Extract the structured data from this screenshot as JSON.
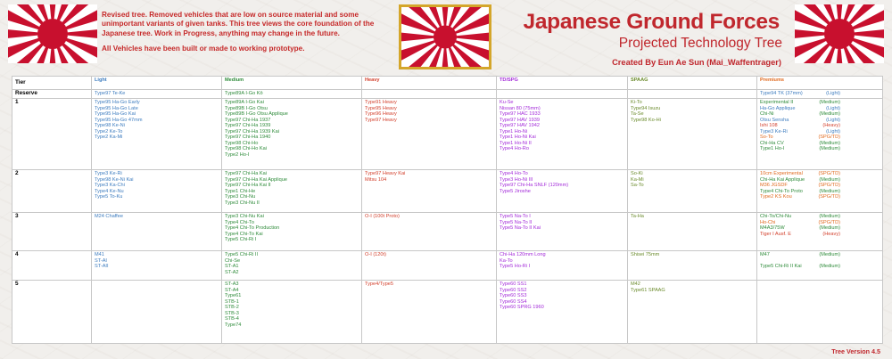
{
  "intro": {
    "p1": "Revised tree. Removed vehicles that are low on source material and some unimportant variants of given tanks. This tree views the core foundation of the Japanese tree. Work in Progress, anything may change in the future.",
    "p2": "All Vehicles have been built or made to working prototype."
  },
  "title": {
    "main": "Japanese Ground Forces",
    "sub": "Projected Technology Tree",
    "by": "Created By Eun Ae Sun (Mai_Waffentrager)"
  },
  "colors": {
    "light": "#3d7cbf",
    "medium": "#2e8b3a",
    "heavy": "#d23e2a",
    "td": "#a32bd9",
    "spaag": "#6b8b2c",
    "premium": "#e06a1f",
    "title": "#c0272d"
  },
  "headers": {
    "tier": "Tier",
    "light": "Light",
    "medium": "Medium",
    "heavy": "Heavy",
    "td": "TD/SPG",
    "spaag": "SPAAG",
    "premiums": "Premiums"
  },
  "rows": [
    {
      "tier": "Reserve",
      "light": [
        "Type97 Te-Ke"
      ],
      "medium": [
        "Type89A I-Go Kō"
      ],
      "heavy": [],
      "td": [],
      "spaag": [],
      "premiums": [
        {
          "name": "Type94 TK (37mm)",
          "tag": "(Light)"
        }
      ]
    },
    {
      "tier": "1",
      "light": [
        "Type95 Ha-Go Early",
        "Type95 Ha-Go Late",
        "Type95 Ha-Go Kai",
        "Type95 Ha-Go 47mm",
        "Type98 Ke-Ni",
        "Type2 Ke-To",
        "Type2 Ka-Mi"
      ],
      "medium": [
        "Type89A I-Go Kai",
        "Type89B I-Go Otsu",
        "Type89B I-Go Otsu Applique",
        "Type97 Chi-Ha 1937",
        "Type97 Chi-Ha 1939",
        "Type97 Chi-Ha 1939 Kai",
        "Type97 Chi-Ha 1940",
        "Type98 Chi-Ho",
        "Type98 Chi-Ho Kai",
        "Type2 Ho-I"
      ],
      "heavy": [
        "Type91 Heavy",
        "Type95 Heavy",
        "Type96 Heavy",
        "Type97 Heavy"
      ],
      "td": [
        "Ku-Se",
        "Nissan 80 (75mm)",
        "Type97 HAC 1933",
        "Type97 HAV 1939",
        "Type97 HAV 1942",
        "Type1 Ho-Ni",
        "Type1 Ho-Ni Kai",
        "Type1 Ho-Ni II",
        "Type4 Ho-Ro"
      ],
      "spaag": [
        "Ki-To",
        "Type94 Isuzu",
        "Ta-Se",
        "Type98 Ko-Hi"
      ],
      "premiums": [
        {
          "name": "Experimental II",
          "tag": "(Medium)"
        },
        {
          "name": "Ha-Go Applique",
          "tag": "(Light)"
        },
        {
          "name": "Chi-Ni",
          "tag": "(Medium)"
        },
        {
          "name": "Otsu Sensha",
          "tag": "(Light)"
        },
        {
          "name": "Ishi 108",
          "tag": "(Heavy)"
        },
        {
          "name": "Type3 Ke-Ri",
          "tag": "(Light)"
        },
        {
          "name": "So-To",
          "tag": "(SPG/TD)"
        },
        {
          "name": "Chi-Ha CV",
          "tag": "(Medium)"
        },
        {
          "name": "Type1 Ho-I",
          "tag": "(Medium)"
        }
      ]
    },
    {
      "tier": "2",
      "light": [
        "Type3 Ke-Ri",
        "Type98 Ke-Ni Kai",
        "Type3 Ka-Chi",
        "Type4 Ke-Nu",
        "Type5 To-Ku"
      ],
      "medium": [
        "Type97 Chi-Ha Kai",
        "Type97 Chi-Ha Kai Applique",
        "Type97 Chi-Ha Kai II",
        "Type1 Chi-He",
        "Type3 Chi-Nu",
        "Type3 Chi-Nu II"
      ],
      "heavy": [
        "Type97 Heavy Kai",
        "Mitsu 104"
      ],
      "td": [
        "Type4 Ho-To",
        "Type3 Ho-Ni III",
        "Type97 Chi-Ha SNLF (120mm)",
        "Type5 Jiroshe"
      ],
      "spaag": [
        "So-Ki",
        "Ka-Mi",
        "Sa-To"
      ],
      "premiums": [
        {
          "name": "10cm Experimental",
          "tag": "(SPG/TD)"
        },
        {
          "name": "Chi-Ha Kai Applique",
          "tag": "(Medium)"
        },
        {
          "name": "M36 JGSDF",
          "tag": "(SPG/TD)"
        },
        {
          "name": "Type4 Chi-To Proto",
          "tag": "(Medium)"
        },
        {
          "name": "Type2 KS Kou",
          "tag": "(SPG/TD)"
        }
      ]
    },
    {
      "tier": "3",
      "light": [
        "M24 Chaffee"
      ],
      "medium": [
        "Type3 Chi-Nu Kai",
        "Type4 Chi-To",
        "Type4 Chi-To Production",
        "Type4 Chi-To Kai",
        "Type5 Chi-Ri I"
      ],
      "heavy": [
        "O-I (100t Proto)"
      ],
      "td": [
        "Type5 Na-To I",
        "Type5 Na-To II",
        "Type5 Na-To II Kai"
      ],
      "spaag": [
        "Ta-Ha"
      ],
      "premiums": [
        {
          "name": "Chi-To/Chi-Nu",
          "tag": "(Medium)"
        },
        {
          "name": "Ho-Chi",
          "tag": "(SPG/TD)"
        },
        {
          "name": "M4A3/75W",
          "tag": "(Medium)"
        },
        {
          "name": "Tiger I Ausf. E",
          "tag": "(Heavy)"
        }
      ]
    },
    {
      "tier": "4",
      "light": [
        "M41",
        "ST-AI",
        "ST-AII"
      ],
      "medium": [
        "Type5 Chi-Ri II",
        "Chi-Se",
        "ST-A1",
        "ST-A2"
      ],
      "heavy": [
        "O-I (120t)"
      ],
      "td": [
        "Chi-Ha 120mm Long",
        "Ka-To",
        "Type5 Ho-Ri I"
      ],
      "spaag": [
        "Shisei 75mm"
      ],
      "premiums": [
        {
          "name": "M47",
          "tag": "(Medium)"
        },
        {
          "name": "",
          "tag": ""
        },
        {
          "name": "Type5 Chi-Ri II Kai",
          "tag": "(Medium)"
        }
      ]
    },
    {
      "tier": "5",
      "light": [],
      "medium": [
        "ST-A3",
        "ST-A4",
        "Type61",
        "STB-1",
        "STB-2",
        "STB-3",
        "STB-4",
        "Type74"
      ],
      "heavy": [
        "Type4/Type5"
      ],
      "td": [
        "Type60 SS1",
        "Type60 SS2",
        "Type60 SS3",
        "Type60 SS4",
        "Type60 SPRG 1960"
      ],
      "spaag": [
        "M42",
        "Type61 SPAAG"
      ],
      "premiums": []
    }
  ],
  "version": "Tree Version 4.5"
}
